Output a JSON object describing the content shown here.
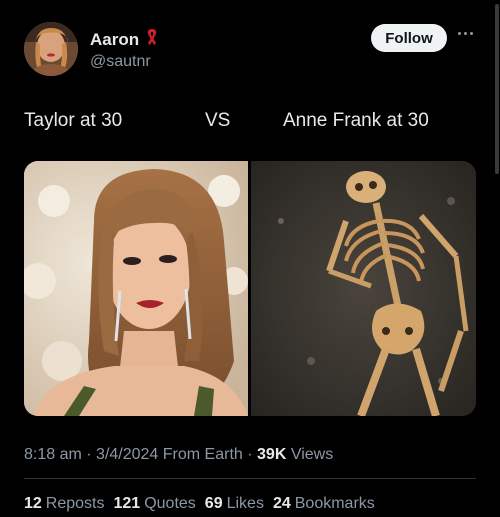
{
  "author": {
    "display_name": "Aaron",
    "handle": "@sautnr",
    "badge_icon": "red-ribbon-icon",
    "avatar_icon": "profile-avatar"
  },
  "actions": {
    "follow_label": "Follow",
    "more_icon": "more-options-icon"
  },
  "tweet": {
    "text_left": "Taylor at 30",
    "text_mid": "VS",
    "text_right": "Anne Frank at 30"
  },
  "media": {
    "left_image": "photo-woman-portrait",
    "right_image": "photo-skeleton-excavation"
  },
  "meta": {
    "time": "8:18 am",
    "sep1": "·",
    "date": "3/4/2024",
    "source": "From Earth",
    "sep2": "·",
    "views_count": "39K",
    "views_label": "Views"
  },
  "stats": [
    {
      "count": "12",
      "label": "Reposts"
    },
    {
      "count": "121",
      "label": "Quotes"
    },
    {
      "count": "69",
      "label": "Likes"
    },
    {
      "count": "24",
      "label": "Bookmarks"
    }
  ],
  "colors": {
    "background": "#000000",
    "text_primary": "#e7e9ea",
    "text_secondary": "#8b98a5",
    "follow_bg": "#eff3f4",
    "ribbon_red": "#d0202a"
  }
}
